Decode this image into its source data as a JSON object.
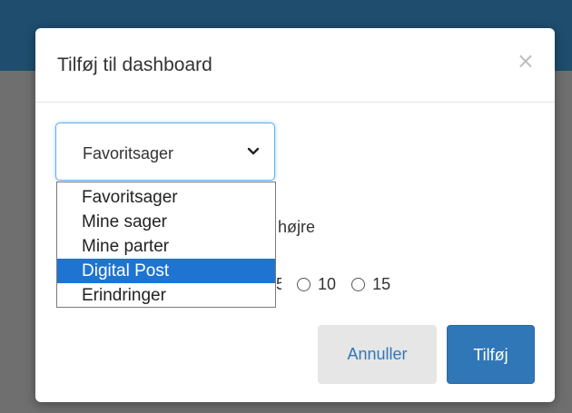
{
  "colors": {
    "header_bg": "#1e4d6e",
    "backdrop": "#6f6f6f",
    "primary": "#2f77b7",
    "option_highlight": "#1f74d1",
    "cancel_bg": "#e6e6e6"
  },
  "dialog": {
    "title": "Tilføj til dashboard",
    "close_icon": "close-icon",
    "close_label": "×"
  },
  "select": {
    "value": "Favoritsager",
    "chevron_icon": "chevron-down-icon",
    "options": [
      {
        "label": "Favoritsager",
        "selected": false
      },
      {
        "label": "Mine sager",
        "selected": false
      },
      {
        "label": "Mine parter",
        "selected": false
      },
      {
        "label": "Digital Post",
        "selected": true
      },
      {
        "label": "Erindringer",
        "selected": false
      }
    ]
  },
  "position": {
    "label_fragment": "højre"
  },
  "count": {
    "partial_label": "5",
    "options": [
      "10",
      "15"
    ]
  },
  "buttons": {
    "cancel_label": "Annuller",
    "add_label": "Tilføj"
  }
}
